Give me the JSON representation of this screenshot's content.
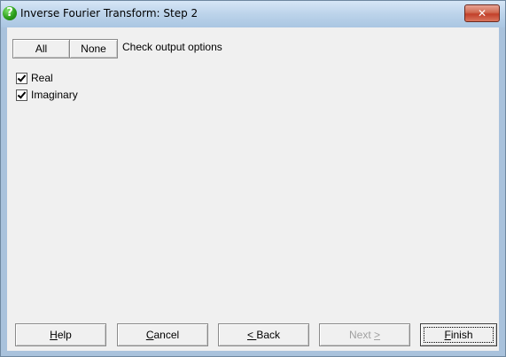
{
  "window": {
    "title": "Inverse Fourier Transform: Step 2",
    "title_icon": "?",
    "close_symbol": "✕"
  },
  "selector": {
    "all_label": "All",
    "none_label": "None",
    "caption": "Check output options"
  },
  "options": [
    {
      "label": "Real",
      "checked": true
    },
    {
      "label": "Imaginary",
      "checked": true
    }
  ],
  "buttons": {
    "help": {
      "underline": "H",
      "rest": "elp"
    },
    "cancel": {
      "underline": "C",
      "rest": "ancel"
    },
    "back": {
      "underline": "< ",
      "rest": "Back"
    },
    "next": {
      "prefix": "Next ",
      "underline": ">",
      "enabled": false
    },
    "finish": {
      "underline": "F",
      "rest": "inish"
    }
  },
  "colors": {
    "title_bar": "#bcd3ea",
    "client_bg": "#f0f0f0",
    "close_button": "#c2402a",
    "disabled_text": "#a0a0a0"
  }
}
